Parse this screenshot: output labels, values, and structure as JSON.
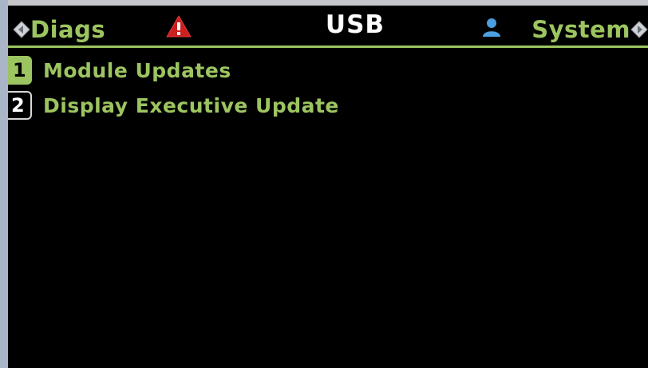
{
  "colors": {
    "accent": "#9cc460",
    "title_text": "#ffffff",
    "warning": "#cc1f1f",
    "user": "#4b9fe0",
    "background": "#000000"
  },
  "header": {
    "left_nav_label": "Diags",
    "title": "USB",
    "right_nav_label": "System",
    "left_arrow_icon": "chevron-left-icon",
    "right_arrow_icon": "chevron-right-icon",
    "status_icons": [
      "warning-icon",
      "user-icon"
    ]
  },
  "menu": {
    "items": [
      {
        "number": "1",
        "label": "Module Updates",
        "selected": true
      },
      {
        "number": "2",
        "label": "Display Executive Update",
        "selected": false
      }
    ]
  }
}
